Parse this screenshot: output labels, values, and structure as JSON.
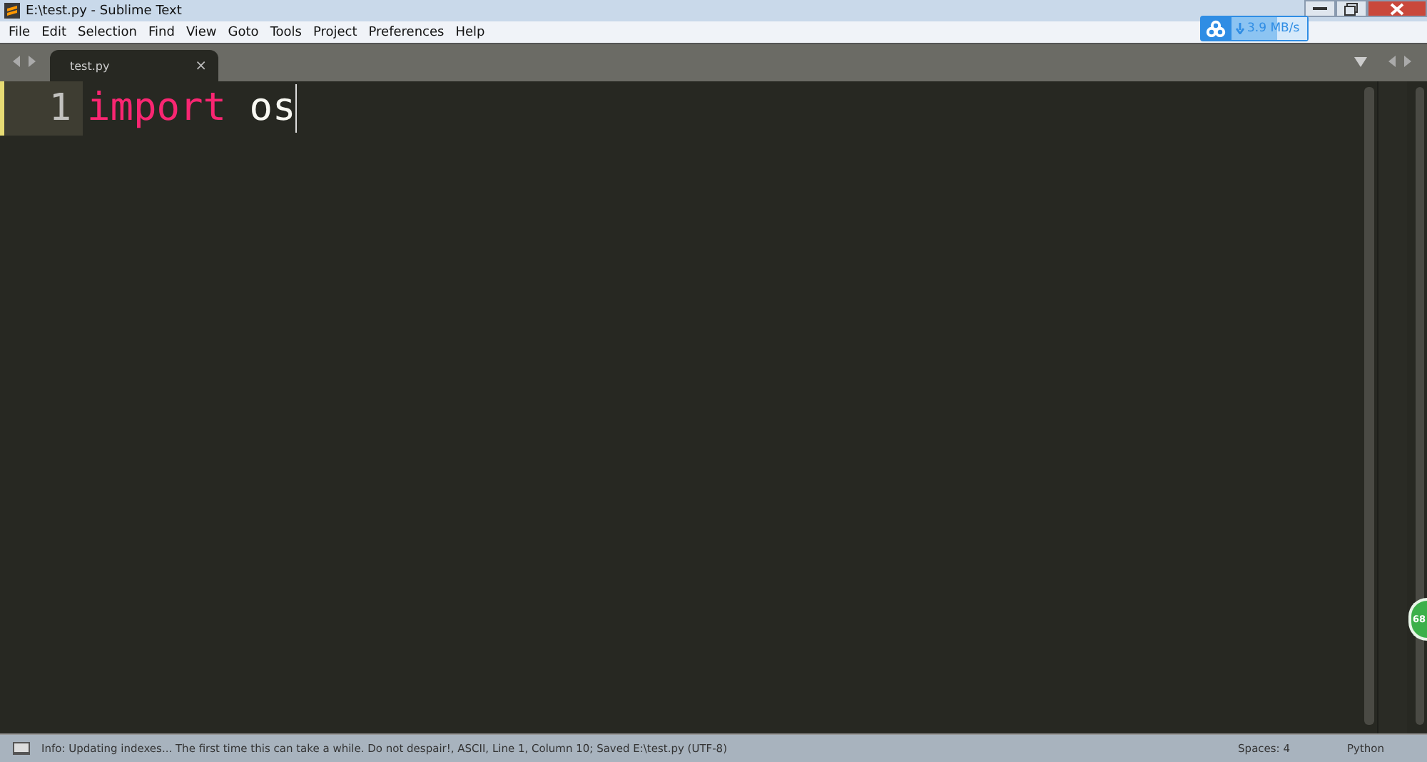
{
  "window": {
    "title": "E:\\test.py - Sublime Text"
  },
  "menu": [
    "File",
    "Edit",
    "Selection",
    "Find",
    "View",
    "Goto",
    "Tools",
    "Project",
    "Preferences",
    "Help"
  ],
  "speed_widget": {
    "reading": "3.9 MB/s",
    "level": 0.6
  },
  "tabs": [
    {
      "label": "test.py",
      "selected": true,
      "close": "×"
    }
  ],
  "editor": {
    "lines": [
      {
        "number": "1",
        "current": true,
        "tokens": [
          {
            "kind": "keyword",
            "text": "import"
          },
          {
            "kind": "plain",
            "text": " os"
          }
        ]
      }
    ]
  },
  "floating_badge": "68",
  "status_bar": {
    "message": "Info: Updating indexes... The first time this can take a while. Do not despair!, ASCII, Line 1, Column 10; Saved E:\\test.py (UTF-8)",
    "indentation": "Spaces: 4",
    "syntax": "Python"
  }
}
